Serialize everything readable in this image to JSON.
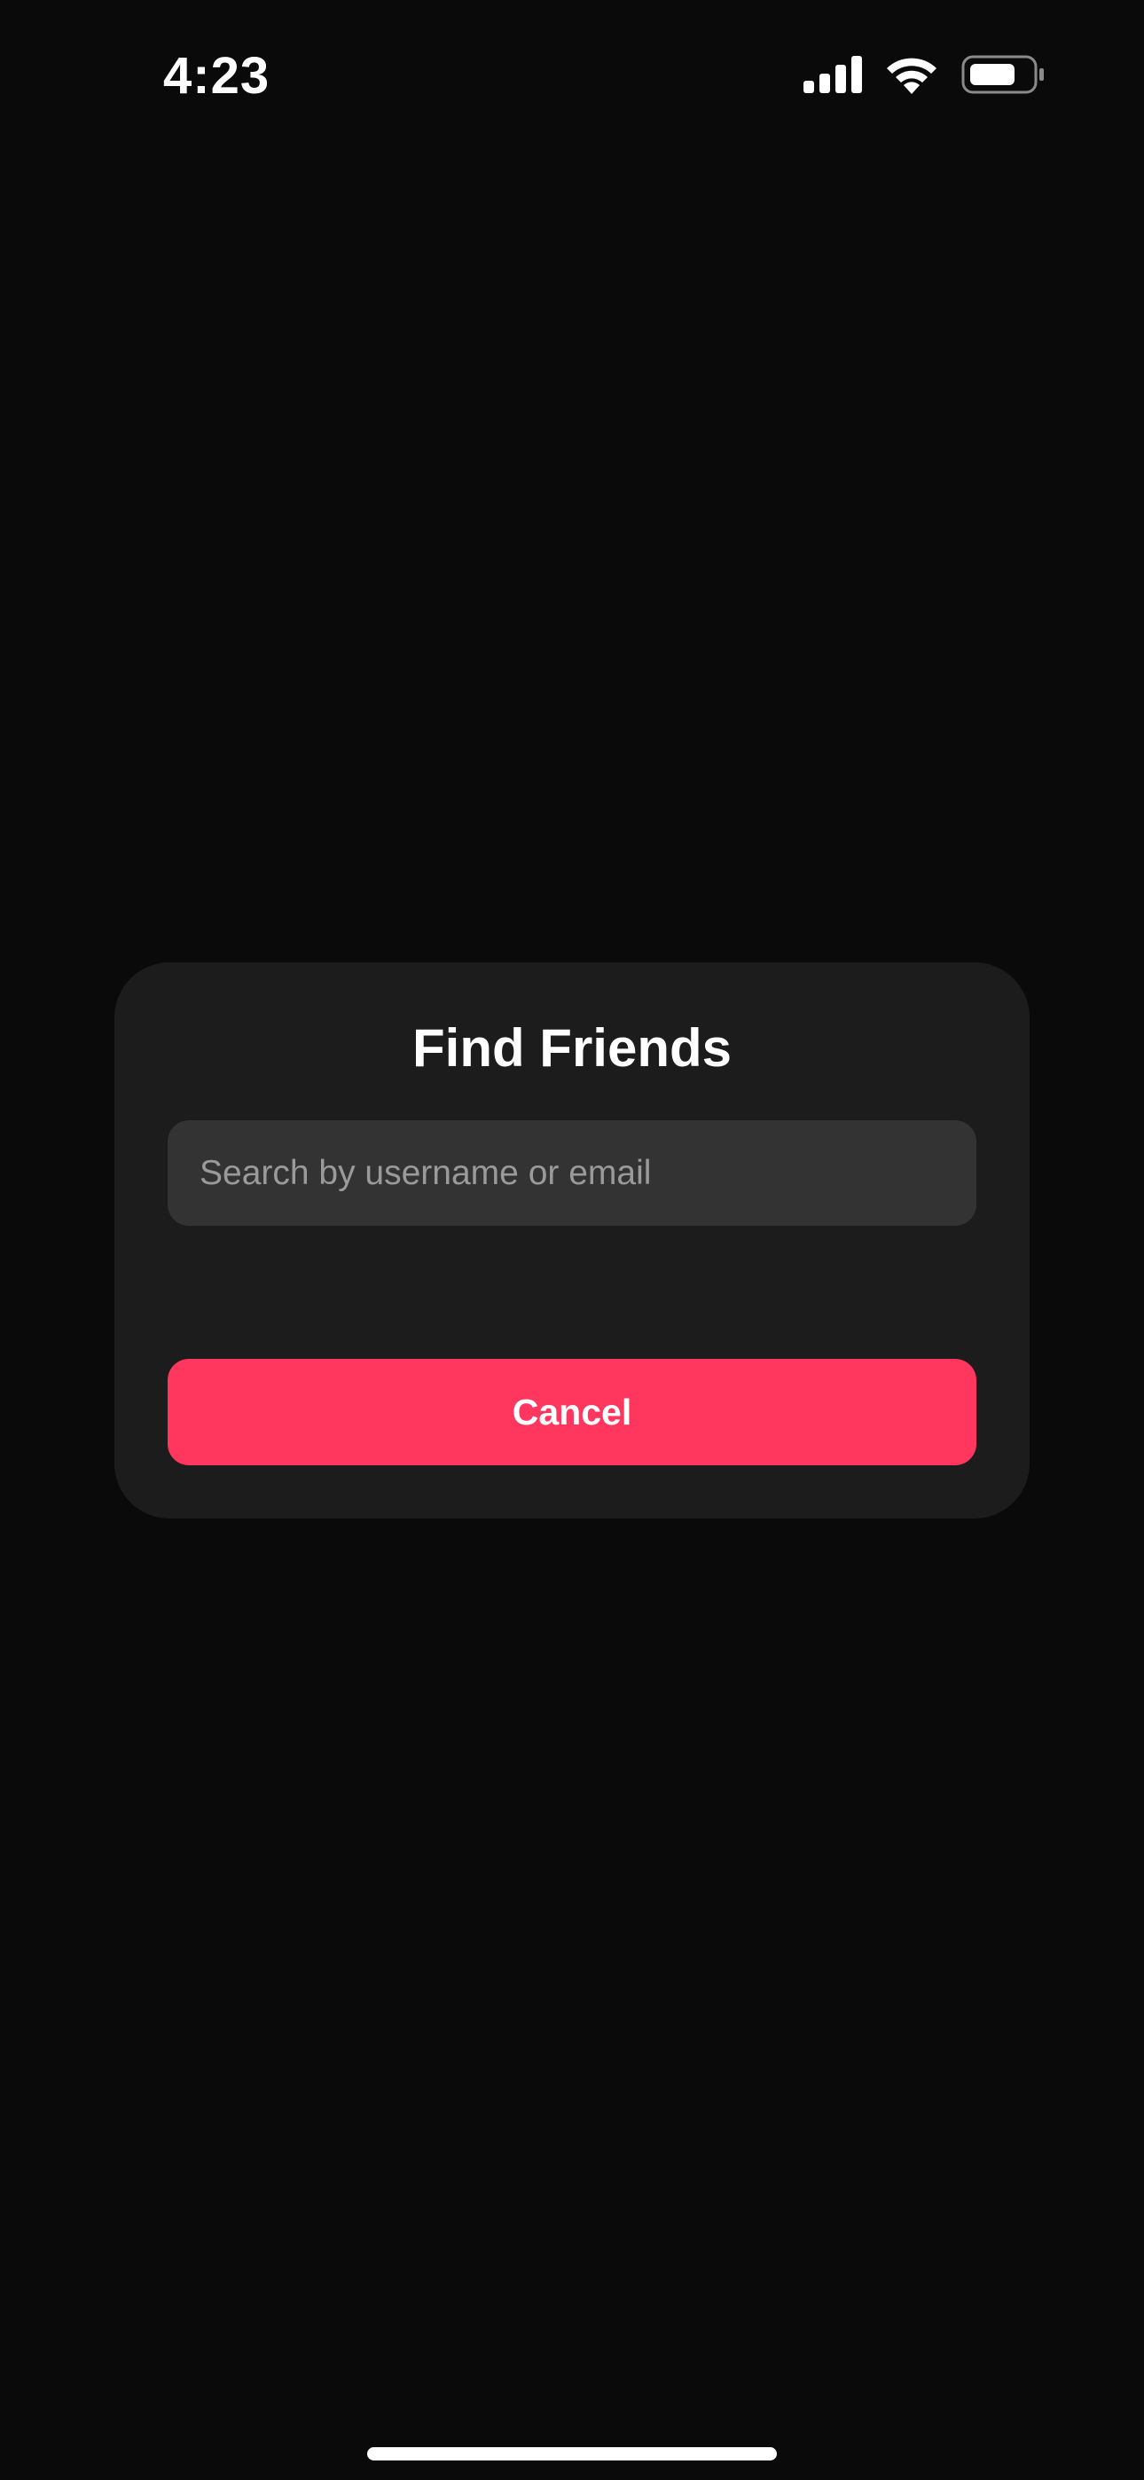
{
  "status_bar": {
    "time": "4:23",
    "icons": [
      "signal-icon",
      "wifi-icon",
      "battery-icon"
    ]
  },
  "dialog": {
    "title": "Find Friends",
    "search": {
      "placeholder": "Search by username or email",
      "value": ""
    },
    "cancel_label": "Cancel"
  },
  "colors": {
    "background": "#0a0a0a",
    "dialog_background": "#1c1c1c",
    "input_background": "#333333",
    "accent": "#ff375f",
    "placeholder": "#9a9a9a"
  }
}
